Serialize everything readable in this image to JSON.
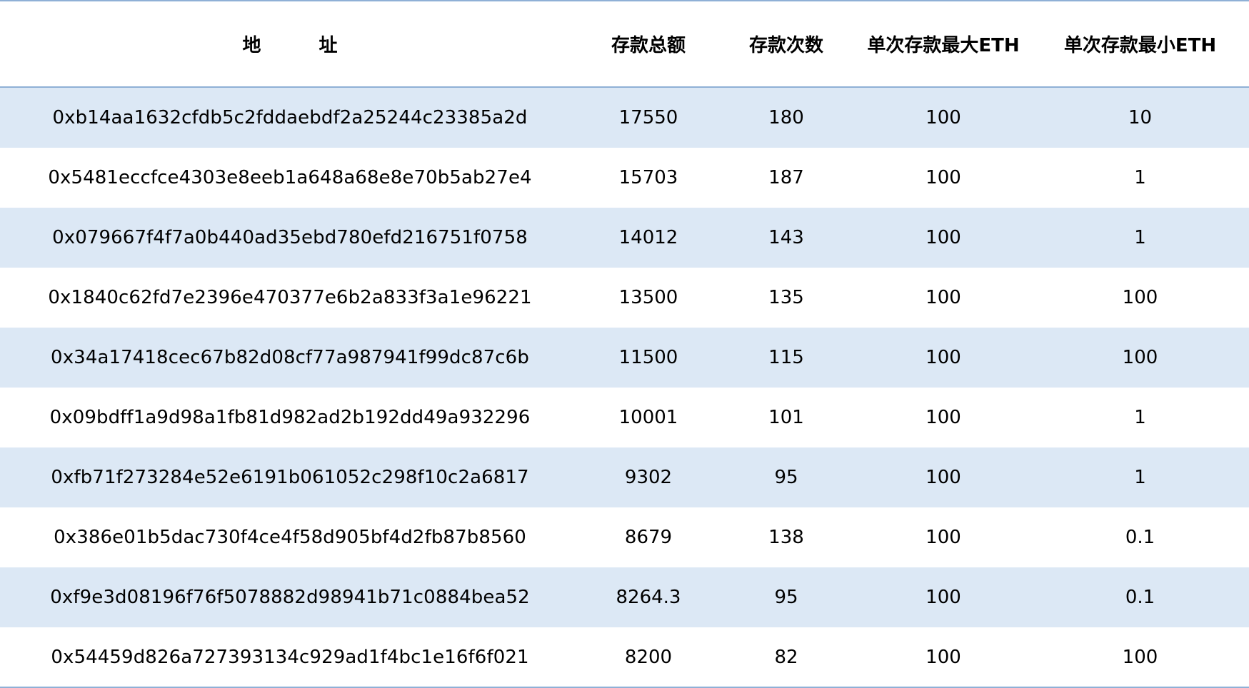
{
  "table": {
    "headers": {
      "address": "地 址",
      "total": "存款总额",
      "count": "存款次数",
      "max": "单次存款最大ETH",
      "min": "单次存款最小ETH"
    },
    "rows": [
      {
        "address": "0xb14aa1632cfdb5c2fddaebdf2a25244c23385a2d",
        "total": "17550",
        "count": "180",
        "max": "100",
        "min": "10"
      },
      {
        "address": "0x5481eccfce4303e8eeb1a648a68e8e70b5ab27e4",
        "total": "15703",
        "count": "187",
        "max": "100",
        "min": "1"
      },
      {
        "address": "0x079667f4f7a0b440ad35ebd780efd216751f0758",
        "total": "14012",
        "count": "143",
        "max": "100",
        "min": "1"
      },
      {
        "address": "0x1840c62fd7e2396e470377e6b2a833f3a1e96221",
        "total": "13500",
        "count": "135",
        "max": "100",
        "min": "100"
      },
      {
        "address": "0x34a17418cec67b82d08cf77a987941f99dc87c6b",
        "total": "11500",
        "count": "115",
        "max": "100",
        "min": "100"
      },
      {
        "address": "0x09bdff1a9d98a1fb81d982ad2b192dd49a932296",
        "total": "10001",
        "count": "101",
        "max": "100",
        "min": "1"
      },
      {
        "address": "0xfb71f273284e52e6191b061052c298f10c2a6817",
        "total": "9302",
        "count": "95",
        "max": "100",
        "min": "1"
      },
      {
        "address": "0x386e01b5dac730f4ce4f58d905bf4d2fb87b8560",
        "total": "8679",
        "count": "138",
        "max": "100",
        "min": "0.1"
      },
      {
        "address": "0xf9e3d08196f76f5078882d98941b71c0884bea52",
        "total": "8264.3",
        "count": "95",
        "max": "100",
        "min": "0.1"
      },
      {
        "address": "0x54459d826a727393134c929ad1f4bc1e16f6f021",
        "total": "8200",
        "count": "82",
        "max": "100",
        "min": "100"
      }
    ]
  },
  "colors": {
    "band": "#dce8f5",
    "rule": "#8fb0d6"
  }
}
